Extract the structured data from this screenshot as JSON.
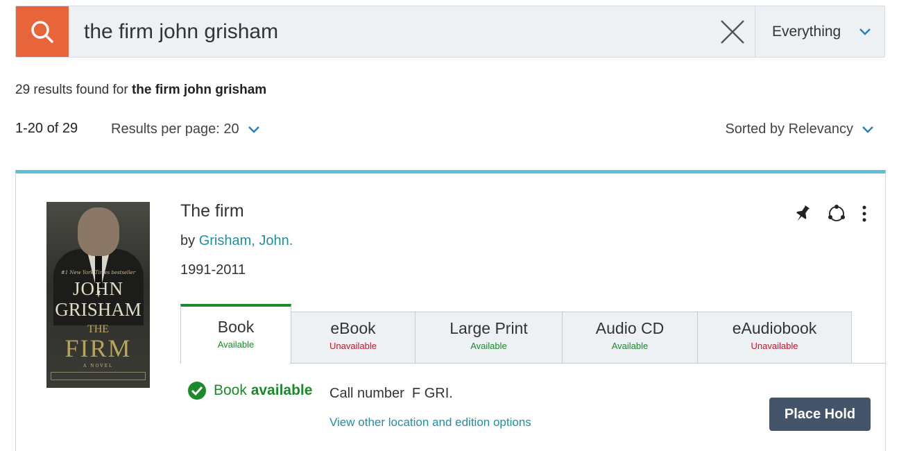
{
  "search": {
    "query": "the firm john grisham",
    "scope": "Everything"
  },
  "summary": {
    "results_prefix": "29 results found for ",
    "results_query": "the firm john grisham",
    "range": "1-20 of 29",
    "per_page": "Results per page: 20",
    "sort": "Sorted by Relevancy"
  },
  "result": {
    "title": "The firm",
    "by_prefix": "by ",
    "author": "Grisham, John.",
    "date": "1991-2011",
    "cover": {
      "tagline": "#1 New York Times bestseller",
      "author_line1": "JOHN",
      "author_line2": "GRISHAM",
      "the": "THE",
      "firm": "FIRM",
      "novel": "A NOVEL"
    },
    "formats": [
      {
        "label": "Book",
        "status": "Available",
        "available": true
      },
      {
        "label": "eBook",
        "status": "Unavailable",
        "available": false
      },
      {
        "label": "Large Print",
        "status": "Available",
        "available": true
      },
      {
        "label": "Audio CD",
        "status": "Available",
        "available": true
      },
      {
        "label": "eAudiobook",
        "status": "Unavailable",
        "available": false
      }
    ],
    "availability_prefix": "Book ",
    "availability_bold": "available",
    "call_number": "Call number  F GRI.",
    "other_locations": "View other location and edition options",
    "place_hold": "Place Hold"
  },
  "colors": {
    "search_accent": "#e8643a",
    "card_accent": "#5bc0d6",
    "available": "#1b8a2a",
    "unavailable": "#c0182a",
    "link": "#1f8fa3",
    "hold_button": "#43546b"
  }
}
